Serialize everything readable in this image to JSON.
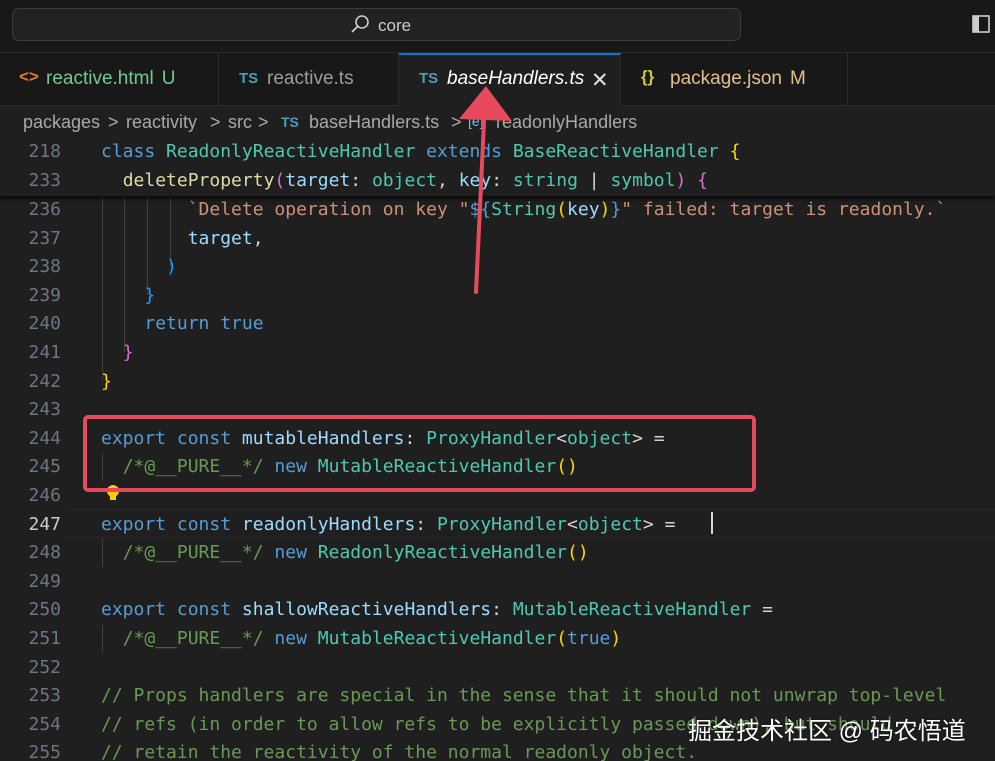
{
  "command_center": {
    "label": "core"
  },
  "tabs": [
    {
      "icon": "<>",
      "name": "reactive.html",
      "badge": "U"
    },
    {
      "icon": "TS",
      "name": "reactive.ts"
    },
    {
      "icon": "TS",
      "name": "baseHandlers.ts",
      "close": "✕"
    },
    {
      "icon": "{}",
      "name": "package.json",
      "badge": "M"
    }
  ],
  "breadcrumb": {
    "parts": [
      "packages",
      "reactivity",
      "src",
      "baseHandlers.ts",
      "readonlyHandlers"
    ],
    "separator": ">",
    "file_icon": "TS",
    "symbol_icon": "[e]"
  },
  "editor": {
    "sticky": [
      {
        "ln": "218",
        "tokens": [
          [
            "kw",
            "class "
          ],
          [
            "ty",
            "ReadonlyReactiveHandler "
          ],
          [
            "kw",
            "extends "
          ],
          [
            "ty",
            "BaseReactiveHandler "
          ],
          [
            "br1",
            "{"
          ]
        ]
      },
      {
        "ln": "233",
        "tokens": [
          [
            "pl",
            "  "
          ],
          [
            "fn",
            "deleteProperty"
          ],
          [
            "br2",
            "("
          ],
          [
            "vr",
            "target"
          ],
          [
            "pl",
            ": "
          ],
          [
            "ty",
            "object"
          ],
          [
            "pl",
            ", "
          ],
          [
            "vr",
            "key"
          ],
          [
            "pl",
            ": "
          ],
          [
            "ty",
            "string "
          ],
          [
            "pl",
            "| "
          ],
          [
            "ty",
            "symbol"
          ],
          [
            "br2",
            ")"
          ],
          [
            "pl",
            " "
          ],
          [
            "br2",
            "{"
          ]
        ]
      }
    ],
    "lines": [
      {
        "ln": "236",
        "tokens": [
          [
            "pl",
            "        "
          ],
          [
            "st",
            "`Delete operation on key \""
          ],
          [
            "kw",
            "${"
          ],
          [
            "ty",
            "String"
          ],
          [
            "br1",
            "("
          ],
          [
            "vr",
            "key"
          ],
          [
            "br1",
            ")"
          ],
          [
            "kw",
            "}"
          ],
          [
            "st",
            "\" failed: target is readonly.`"
          ]
        ]
      },
      {
        "ln": "237",
        "tokens": [
          [
            "pl",
            "        "
          ],
          [
            "vr",
            "target"
          ],
          [
            "pl",
            ","
          ]
        ]
      },
      {
        "ln": "238",
        "tokens": [
          [
            "pl",
            "      "
          ],
          [
            "br3",
            ")"
          ]
        ]
      },
      {
        "ln": "239",
        "tokens": [
          [
            "pl",
            "    "
          ],
          [
            "br3",
            "}"
          ]
        ]
      },
      {
        "ln": "240",
        "tokens": [
          [
            "pl",
            "    "
          ],
          [
            "kw",
            "return "
          ],
          [
            "kw",
            "true"
          ]
        ]
      },
      {
        "ln": "241",
        "tokens": [
          [
            "pl",
            "  "
          ],
          [
            "br2",
            "}"
          ]
        ]
      },
      {
        "ln": "242",
        "tokens": [
          [
            "br1",
            "}"
          ]
        ]
      },
      {
        "ln": "243",
        "tokens": []
      },
      {
        "ln": "244",
        "tokens": [
          [
            "kw",
            "export "
          ],
          [
            "kw",
            "const "
          ],
          [
            "vr",
            "mutableHandlers"
          ],
          [
            "pl",
            ": "
          ],
          [
            "ty",
            "ProxyHandler"
          ],
          [
            "pl",
            "<"
          ],
          [
            "ty",
            "object"
          ],
          [
            "pl",
            "> ="
          ]
        ]
      },
      {
        "ln": "245",
        "tokens": [
          [
            "pl",
            "  "
          ],
          [
            "cm",
            "/*@__PURE__*/ "
          ],
          [
            "kw",
            "new "
          ],
          [
            "ty",
            "MutableReactiveHandler"
          ],
          [
            "br1",
            "()"
          ]
        ]
      },
      {
        "ln": "246",
        "tokens": []
      },
      {
        "ln": "247",
        "tokens": [
          [
            "kw",
            "export "
          ],
          [
            "kw",
            "const "
          ],
          [
            "vr",
            "readonlyHandlers"
          ],
          [
            "pl",
            ": "
          ],
          [
            "ty",
            "ProxyHandler"
          ],
          [
            "pl",
            "<"
          ],
          [
            "ty",
            "object"
          ],
          [
            "pl",
            "> ="
          ]
        ]
      },
      {
        "ln": "248",
        "tokens": [
          [
            "pl",
            "  "
          ],
          [
            "cm",
            "/*@__PURE__*/ "
          ],
          [
            "kw",
            "new "
          ],
          [
            "ty",
            "ReadonlyReactiveHandler"
          ],
          [
            "br1",
            "()"
          ]
        ]
      },
      {
        "ln": "249",
        "tokens": []
      },
      {
        "ln": "250",
        "tokens": [
          [
            "kw",
            "export "
          ],
          [
            "kw",
            "const "
          ],
          [
            "vr",
            "shallowReactiveHandlers"
          ],
          [
            "pl",
            ": "
          ],
          [
            "ty",
            "MutableReactiveHandler "
          ],
          [
            "pl",
            "="
          ]
        ]
      },
      {
        "ln": "251",
        "tokens": [
          [
            "pl",
            "  "
          ],
          [
            "cm",
            "/*@__PURE__*/ "
          ],
          [
            "kw",
            "new "
          ],
          [
            "ty",
            "MutableReactiveHandler"
          ],
          [
            "br1",
            "("
          ],
          [
            "kw",
            "true"
          ],
          [
            "br1",
            ")"
          ]
        ]
      },
      {
        "ln": "252",
        "tokens": []
      },
      {
        "ln": "253",
        "tokens": [
          [
            "cm",
            "// Props handlers are special in the sense that it should not unwrap top-level"
          ]
        ]
      },
      {
        "ln": "254",
        "tokens": [
          [
            "cm",
            "// refs (in order to allow refs to be explicitly passed down), but should"
          ]
        ]
      },
      {
        "ln": "255",
        "tokens": [
          [
            "cm",
            "// retain the reactivity of the normal readonly object."
          ]
        ]
      }
    ],
    "current_line": "247"
  },
  "watermark": "掘金技术社区 @ 码农悟道",
  "colors": {
    "accent": "#0078d4",
    "highlight": "#e64a5c",
    "ts_icon": "#519aba",
    "html_icon": "#e37933",
    "json_icon": "#cbcb41"
  }
}
